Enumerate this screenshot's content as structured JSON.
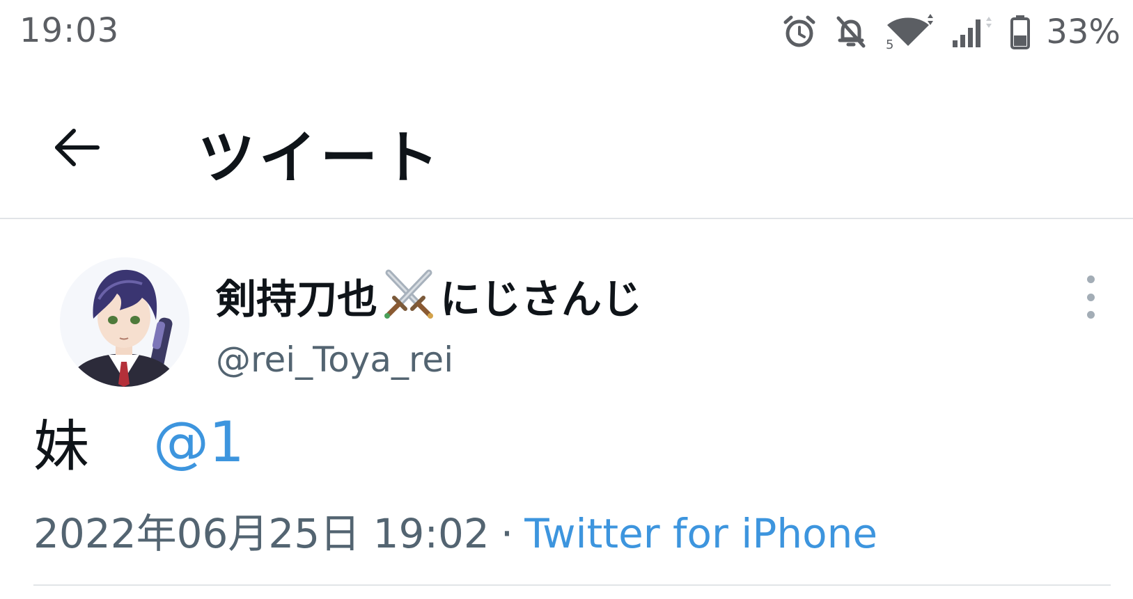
{
  "status_bar": {
    "time": "19:03",
    "battery_percent": "33%",
    "icons": [
      "alarm-icon",
      "notifications-off-icon",
      "wifi-icon",
      "cellular-signal-icon",
      "battery-icon"
    ]
  },
  "header": {
    "title": "ツイート",
    "back_icon": "arrow-left-icon"
  },
  "tweet": {
    "display_name": "剣持刀也",
    "display_name_emoji": "crossed-swords-emoji",
    "display_name_suffix": "にじさんじ",
    "handle": "@rei_Toya_rei",
    "body": "妹",
    "mention": "@1",
    "timestamp": "2022年06月25日 19:02",
    "separator": "·",
    "source": "Twitter for iPhone",
    "more_icon": "more-vertical-icon"
  },
  "colors": {
    "link": "#3d95de",
    "text_primary": "#0f1419",
    "text_secondary": "#536471",
    "status_gray": "#5b5e63",
    "divider": "#e1e4e7"
  }
}
